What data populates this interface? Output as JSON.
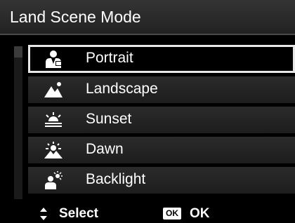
{
  "title": "Land Scene Mode",
  "menu": {
    "items": [
      {
        "label": "Portrait",
        "icon": "portrait-icon",
        "selected": true
      },
      {
        "label": "Landscape",
        "icon": "landscape-icon",
        "selected": false
      },
      {
        "label": "Sunset",
        "icon": "sunset-icon",
        "selected": false
      },
      {
        "label": "Dawn",
        "icon": "dawn-icon",
        "selected": false
      },
      {
        "label": "Backlight",
        "icon": "backlight-icon",
        "selected": false
      }
    ]
  },
  "footer": {
    "select_label": "Select",
    "ok_badge": "OK",
    "ok_label": "OK"
  }
}
